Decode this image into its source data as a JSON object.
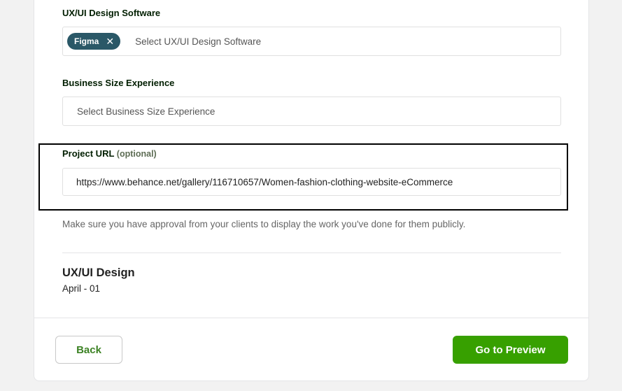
{
  "software_field": {
    "label": "UX/UI Design Software",
    "chip_label": "Figma",
    "chip_remove_icon": "close-icon",
    "placeholder": "Select UX/UI Design Software"
  },
  "business_size_field": {
    "label": "Business Size Experience",
    "placeholder": "Select Business Size Experience"
  },
  "project_url_field": {
    "label": "Project URL",
    "optional_label": "(optional)",
    "value": "https://www.behance.net/gallery/116710657/Women-fashion-clothing-website-eCommerce",
    "help_text": "Make sure you have approval from your clients to display the work you've done for them publicly."
  },
  "summary": {
    "title": "UX/UI Design",
    "subtitle": "April - 01"
  },
  "footer": {
    "back_label": "Back",
    "preview_label": "Go to Preview"
  },
  "colors": {
    "accent_green": "#37a000",
    "chip_bg": "#2a5867",
    "highlight_border": "#000000"
  }
}
